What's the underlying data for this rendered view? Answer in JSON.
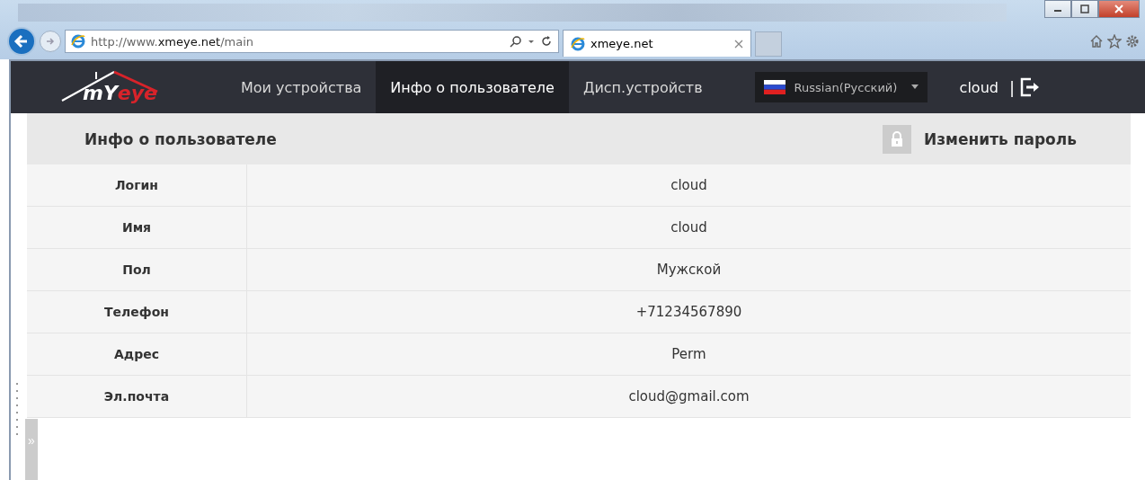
{
  "browser": {
    "address": {
      "prefix": "http://www.",
      "domain": "xmeye.net",
      "path": "/main"
    },
    "tabs": [
      {
        "title": "xmeye.net",
        "selected": true
      }
    ]
  },
  "logo": {
    "part_1": "mY",
    "part_2": "eye"
  },
  "nav": [
    {
      "label": "Мои устройства",
      "selected": false
    },
    {
      "label": "Инфо о пользователе",
      "selected": true
    },
    {
      "label": "Дисп.устройств",
      "selected": false
    }
  ],
  "language": "Russian(Русский)",
  "user": "cloud",
  "separator": "|",
  "panel": {
    "title": "Инфо о пользователе",
    "action": "Изменить пароль"
  },
  "rows": [
    {
      "label": "Логин",
      "value": "cloud"
    },
    {
      "label": "Имя",
      "value": "cloud"
    },
    {
      "label": "Пол",
      "value": "Мужской"
    },
    {
      "label": "Телефон",
      "value": "+71234567890"
    },
    {
      "label": "Адрес",
      "value": "Perm"
    },
    {
      "label": "Эл.почта",
      "value": "cloud@gmail.com"
    }
  ],
  "side_toggle": "»"
}
